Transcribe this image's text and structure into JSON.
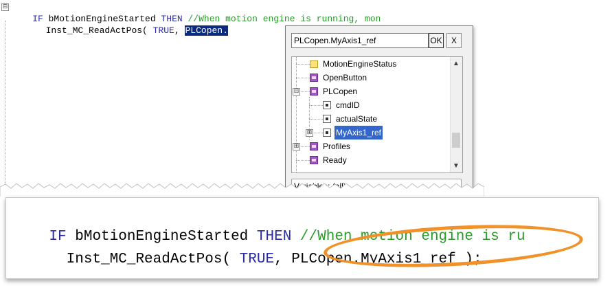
{
  "editor": {
    "line1": {
      "fold": "⊟",
      "kw_if": "IF",
      "var": " bMotionEngineStarted ",
      "kw_then": "THEN",
      "comment": " //When motion engine is running, mon"
    },
    "line2": {
      "indent": "   Inst_MC_ReadActPos( ",
      "kw_true": "TRUE",
      "comma": ", ",
      "selected": "PLCopen."
    }
  },
  "popup": {
    "search_value": "PLCopen.MyAxis1_ref",
    "ok_label": "OK",
    "close_label": "X",
    "tree_items": [
      {
        "label": "MotionEngineStatus",
        "icon": "folder-icon"
      },
      {
        "label": "OpenButton",
        "icon": "struct-icon"
      },
      {
        "label": "PLCopen",
        "icon": "struct-icon",
        "expander": "⊟"
      },
      {
        "label": "cmdID",
        "icon": "input-variable-icon"
      },
      {
        "label": "actualState",
        "icon": "output-variable-icon"
      },
      {
        "label": "MyAxis1_ref",
        "icon": "reference-variable-icon",
        "expander": "⊞",
        "selected": true
      },
      {
        "label": "Profiles",
        "icon": "struct-icon",
        "expander": "⊞"
      },
      {
        "label": "Ready",
        "icon": "struct-icon"
      }
    ],
    "filter_value": "Variables: (all)",
    "scroll_up": "▲",
    "scroll_down": "▼"
  },
  "zoom": {
    "line1": {
      "kw_if": "IF",
      "var": " bMotionEngineStarted ",
      "kw_then": "THEN",
      "comment": " //When motion engine is ru"
    },
    "line2": {
      "indent": "  Inst_MC_ReadActPos( ",
      "kw_true": "TRUE",
      "rest": ", PLCopen.MyAxis1_ref );"
    },
    "highlight_color": "#f0912a"
  },
  "colors": {
    "keyword": "#2a2aa8",
    "comment": "#2a9a2a",
    "selection": "#0a2a80",
    "tree_selection": "#3366cc"
  }
}
